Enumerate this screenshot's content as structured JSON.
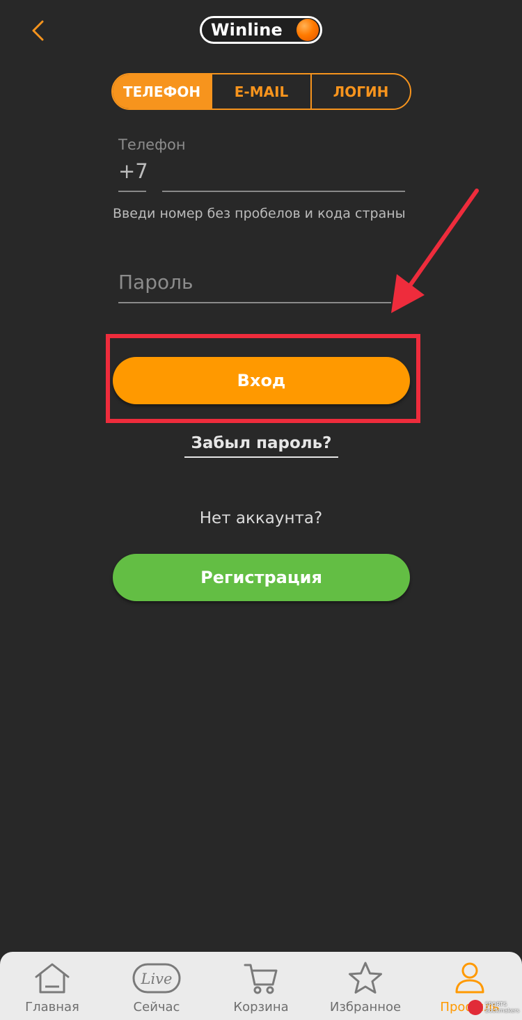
{
  "header": {
    "back_icon": "chevron-left-icon",
    "logo_text": "Winline"
  },
  "tabs": [
    {
      "label": "ТЕЛЕФОН",
      "active": true
    },
    {
      "label": "E-MAIL",
      "active": false
    },
    {
      "label": "ЛОГИН",
      "active": false
    }
  ],
  "phone": {
    "label": "Телефон",
    "prefix": "+7",
    "value": "",
    "hint": "Введи номер без пробелов и кода страны"
  },
  "password": {
    "placeholder": "Пароль",
    "value": ""
  },
  "login_button": "Вход",
  "forgot_link": "Забыл пароль?",
  "no_account_text": "Нет аккаунта?",
  "register_button": "Регистрация",
  "bottom_nav": [
    {
      "label": "Главная",
      "icon": "home-icon",
      "active": false
    },
    {
      "label": "Сейчас",
      "icon": "live-icon",
      "icon_text": "Live",
      "active": false
    },
    {
      "label": "Корзина",
      "icon": "cart-icon",
      "active": false
    },
    {
      "label": "Избранное",
      "icon": "star-icon",
      "active": false
    },
    {
      "label": "Профиль",
      "icon": "user-icon",
      "active": true
    }
  ],
  "watermark": {
    "line1": "SPORTS",
    "line2": "Bookmakers"
  },
  "colors": {
    "background": "#282828",
    "accent_orange": "#ff9900",
    "register_green": "#63be44",
    "highlight_red": "#ee2c3c",
    "nav_background": "#ebebeb"
  }
}
